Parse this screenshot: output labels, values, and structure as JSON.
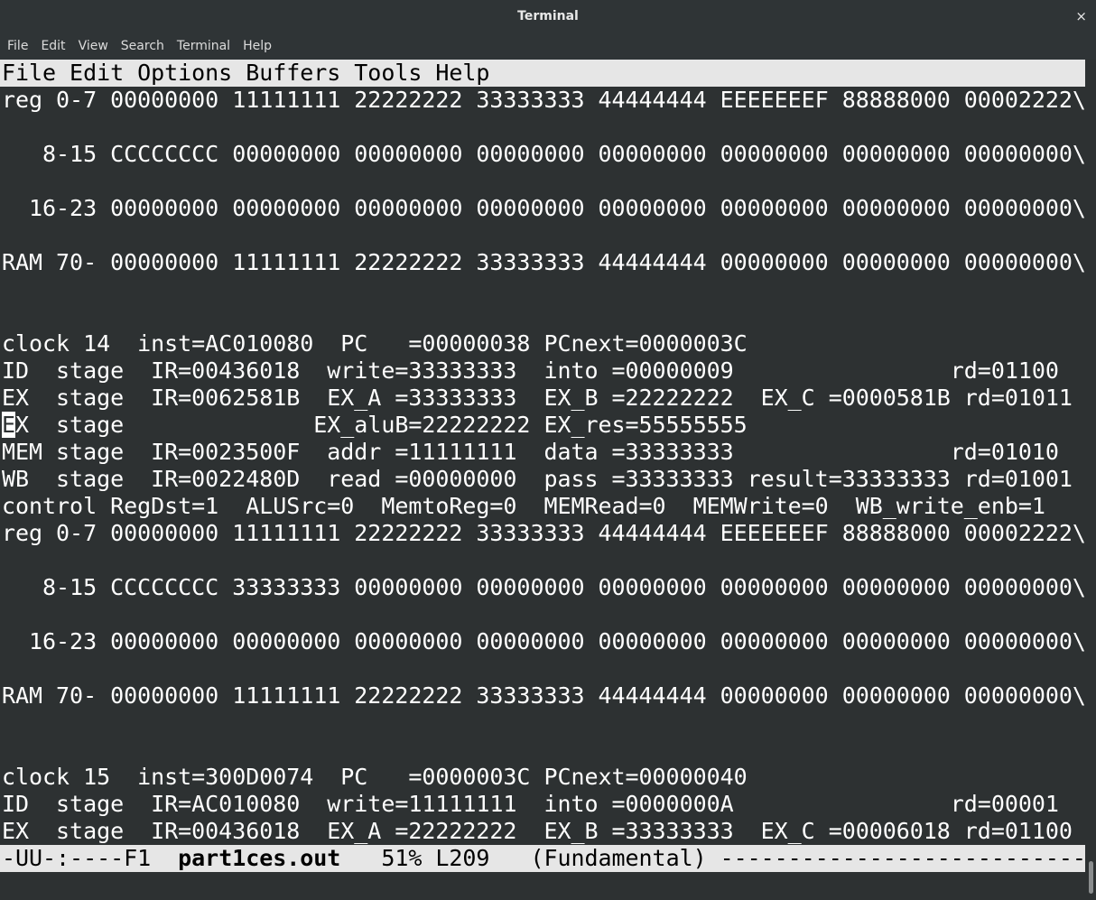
{
  "window": {
    "title": "Terminal",
    "close_glyph": "×"
  },
  "menubar": [
    "File",
    "Edit",
    "View",
    "Search",
    "Terminal",
    "Help"
  ],
  "emacs_menu": "File Edit Options Buffers Tools Help",
  "lines": [
    "reg 0-7 00000000 11111111 22222222 33333333 44444444 EEEEEEEF 88888000 00002222\\",
    "",
    "   8-15 CCCCCCCC 00000000 00000000 00000000 00000000 00000000 00000000 00000000\\",
    "",
    "  16-23 00000000 00000000 00000000 00000000 00000000 00000000 00000000 00000000\\",
    "",
    "RAM 70- 00000000 11111111 22222222 33333333 44444444 00000000 00000000 00000000\\",
    "",
    "",
    "clock 14  inst=AC010080  PC   =00000038 PCnext=0000003C",
    "ID  stage  IR=00436018  write=33333333  into =00000009                rd=01100",
    "EX  stage  IR=0062581B  EX_A =33333333  EX_B =22222222  EX_C =0000581B rd=01011",
    "EX  stage              EX_aluB=22222222 EX_res=55555555",
    "MEM stage  IR=0023500F  addr =11111111  data =33333333                rd=01010",
    "WB  stage  IR=0022480D  read =00000000  pass =33333333 result=33333333 rd=01001",
    "control RegDst=1  ALUSrc=0  MemtoReg=0  MEMRead=0  MEMWrite=0  WB_write_enb=1",
    "reg 0-7 00000000 11111111 22222222 33333333 44444444 EEEEEEEF 88888000 00002222\\",
    "",
    "   8-15 CCCCCCCC 33333333 00000000 00000000 00000000 00000000 00000000 00000000\\",
    "",
    "  16-23 00000000 00000000 00000000 00000000 00000000 00000000 00000000 00000000\\",
    "",
    "RAM 70- 00000000 11111111 22222222 33333333 44444444 00000000 00000000 00000000\\",
    "",
    "",
    "clock 15  inst=300D0074  PC   =0000003C PCnext=00000040",
    "ID  stage  IR=AC010080  write=11111111  into =0000000A                rd=00001",
    "EX  stage  IR=00436018  EX_A =22222222  EX_B =33333333  EX_C =00006018 rd=01100"
  ],
  "cursor_line_index": 12,
  "modeline": {
    "status": "-UU-:----F1  ",
    "buffer": "part1ces.out",
    "position": "   51% L209   (Fundamental) ------------------------------------------"
  }
}
